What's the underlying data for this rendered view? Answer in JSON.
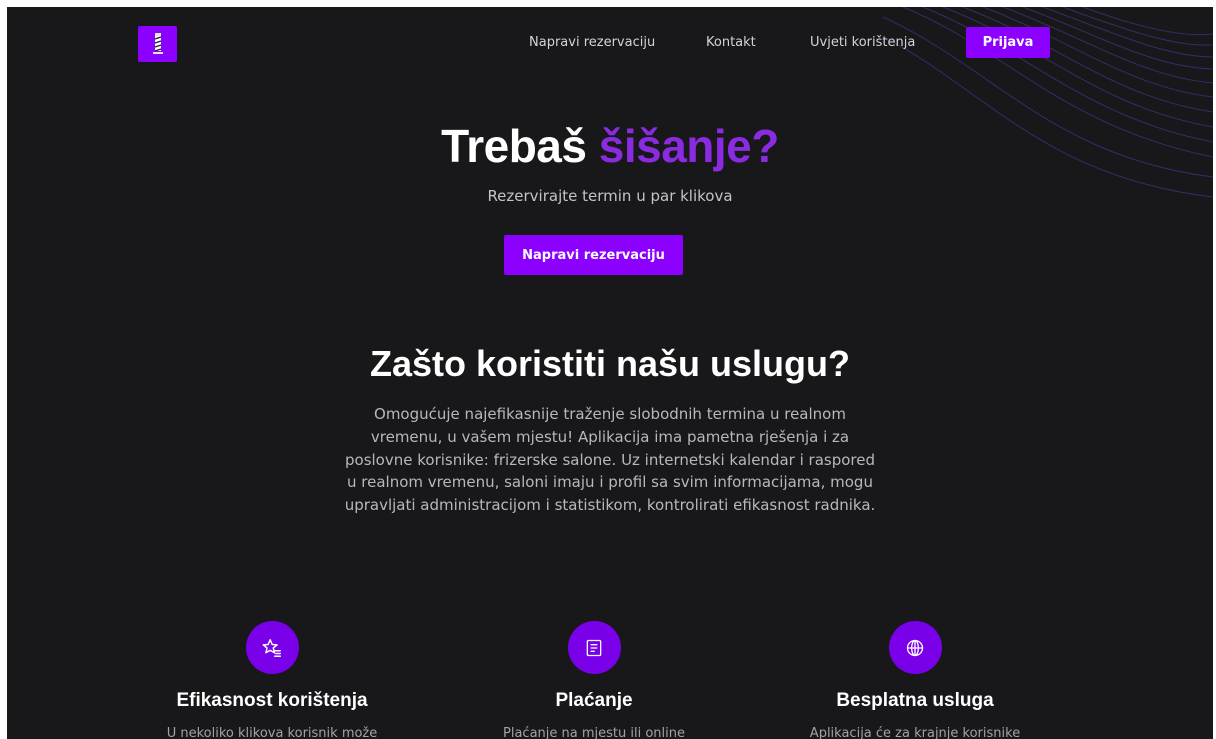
{
  "nav": {
    "links": [
      "Napravi rezervaciju",
      "Kontakt",
      "Uvjeti korištenja"
    ],
    "login_label": "Prijava"
  },
  "hero": {
    "title_part1": "Trebaš",
    "title_accent": "šišanje?",
    "subtitle": "Rezervirajte termin u par klikova",
    "cta_label": "Napravi rezervaciju"
  },
  "why": {
    "title": "Zašto koristiti našu uslugu?",
    "text": "Omogućuje najefikasnije traženje slobodnih termina u realnom vremenu, u vašem mjestu! Aplikacija ima pametna rješenja i za poslovne korisnike: frizerske salone. Uz internetski kalendar i raspored u realnom vremenu, saloni imaju i profil sa svim informacijama, mogu upravljati administracijom i statistikom, kontrolirati efikasnost radnika."
  },
  "features": [
    {
      "icon": "star-list-icon",
      "title": "Efikasnost korištenja",
      "desc": "U nekoliko klikova korisnik može"
    },
    {
      "icon": "receipt-icon",
      "title": "Plaćanje",
      "desc": "Plaćanje na mjestu ili online"
    },
    {
      "icon": "globe-icon",
      "title": "Besplatna usluga",
      "desc": "Aplikacija će za krajnje korisnike"
    }
  ],
  "colors": {
    "accent": "#8b00ff",
    "background": "#18181b"
  }
}
